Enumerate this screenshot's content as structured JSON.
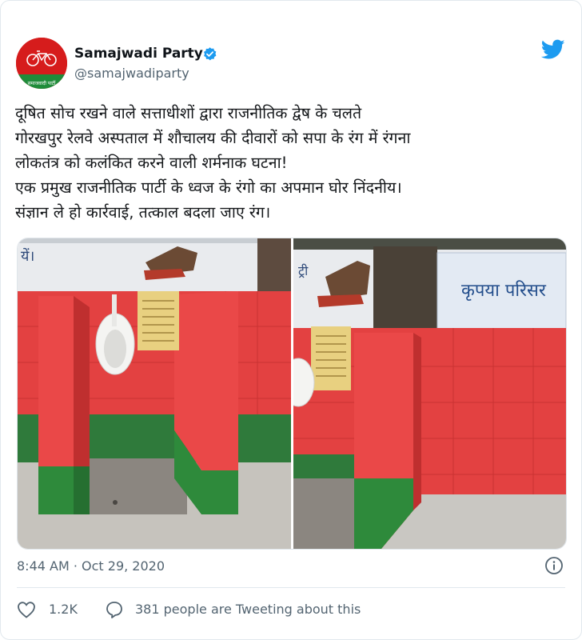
{
  "user": {
    "name": "Samajwadi Party",
    "handle": "@samajwadiparty",
    "avatar_text": "समाजवादी पार्टी"
  },
  "tweet": {
    "lines": [
      "दूषित सोच रखने वाले सत्ताधीशों द्वारा राजनीतिक द्वेष के चलते",
      "गोरखपुर रेलवे अस्पताल में शौचालय की दीवारों को सपा के रंग में रंगना",
      "लोकतंत्र को कलंकित करने वाली शर्मनाक घटना!",
      "एक प्रमुख राजनीतिक पार्टी के ध्वज के रंगो का अपमान घोर निंदनीय।",
      "संज्ञान ले हो कार्रवाई, तत्काल बदला जाए रंग।"
    ]
  },
  "media": {
    "photo1_sign_text": "यें।",
    "photo2_sign_text": "कृपया परिसर",
    "photo2_top_text": "ट्री"
  },
  "meta": {
    "timestamp": "8:44 AM · Oct 29, 2020",
    "likes": "1.2K",
    "people_tweeting": "381 people are Tweeting about this"
  },
  "colors": {
    "twitter_blue": "#1d9bf0",
    "wall_red": "#e03b3b",
    "wall_green": "#2d8a3e"
  }
}
